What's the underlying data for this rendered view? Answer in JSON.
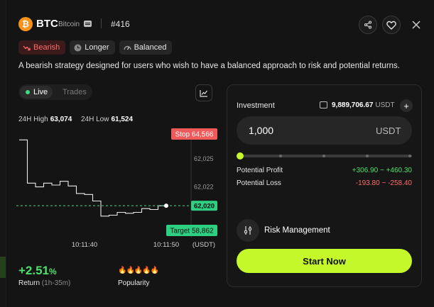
{
  "header": {
    "symbol": "BTC",
    "name": "Bitcoin",
    "rank": "#416",
    "coin_icon": "bitcoin-icon",
    "coin_glyph": "₿"
  },
  "tags": [
    {
      "label": "Bearish",
      "icon": "trend-down-icon"
    },
    {
      "label": "Longer",
      "icon": "clock-icon"
    },
    {
      "label": "Balanced",
      "icon": "gauge-icon"
    }
  ],
  "description": "A bearish strategy designed for users who wish to have a balanced approach to risk and potential returns.",
  "view_toggle": {
    "live": "Live",
    "trades": "Trades"
  },
  "stats": {
    "high_label": "24H High",
    "high_value": "63,074",
    "low_label": "24H Low",
    "low_value": "61,524"
  },
  "chart_data": {
    "type": "line",
    "x": [
      "10:11:32",
      "10:11:33",
      "10:11:34",
      "10:11:35",
      "10:11:36",
      "10:11:37",
      "10:11:38",
      "10:11:39",
      "10:11:40",
      "10:11:41",
      "10:11:42",
      "10:11:43",
      "10:11:44",
      "10:11:45",
      "10:11:46",
      "10:11:47",
      "10:11:48",
      "10:11:49",
      "10:11:50"
    ],
    "y": [
      62027.0,
      62022.4,
      62022.0,
      62022.4,
      62022.2,
      62022.6,
      62022.1,
      62021.3,
      62021.2,
      62020.5,
      62018.9,
      62019.0,
      62019.3,
      62019.2,
      62019.3,
      62019.7,
      62019.6,
      62020.0,
      62020.0
    ],
    "ylim": [
      62017,
      62028
    ],
    "yticks": [
      62025,
      62022
    ],
    "ytick_labels": [
      "62,025",
      "62,022"
    ],
    "xticks": [
      "10:11:40",
      "10:11:50"
    ],
    "unit_label": "(USDT)",
    "current_value": "62,020",
    "stop_label": "Stop 64,566",
    "target_label": "Target 58,862"
  },
  "performance": {
    "return_value": "+2.51",
    "return_unit": "%",
    "return_label": "Return",
    "return_period": "(1h-35m)",
    "popularity_icons": "🔥🔥🔥🔥🔥",
    "popularity_label": "Popularity"
  },
  "investment": {
    "label": "Investment",
    "balance": "9,889,706.67",
    "balance_unit": "USDT",
    "amount": "1,000",
    "unit": "USDT",
    "slider_level_percent": 0,
    "potential_profit_label": "Potential Profit",
    "potential_profit": "+306.90 ~ +460.30",
    "potential_loss_label": "Potential Loss",
    "potential_loss": "-193.80 ~ -258.40",
    "risk_label": "Risk Management",
    "start_label": "Start Now"
  },
  "colors": {
    "accent": "#c4f82a",
    "positive": "#4ee06a",
    "negative": "#ff6b6b",
    "stop": "#f05a5a",
    "target": "#2dcf82",
    "bitcoin": "#f7931a"
  }
}
